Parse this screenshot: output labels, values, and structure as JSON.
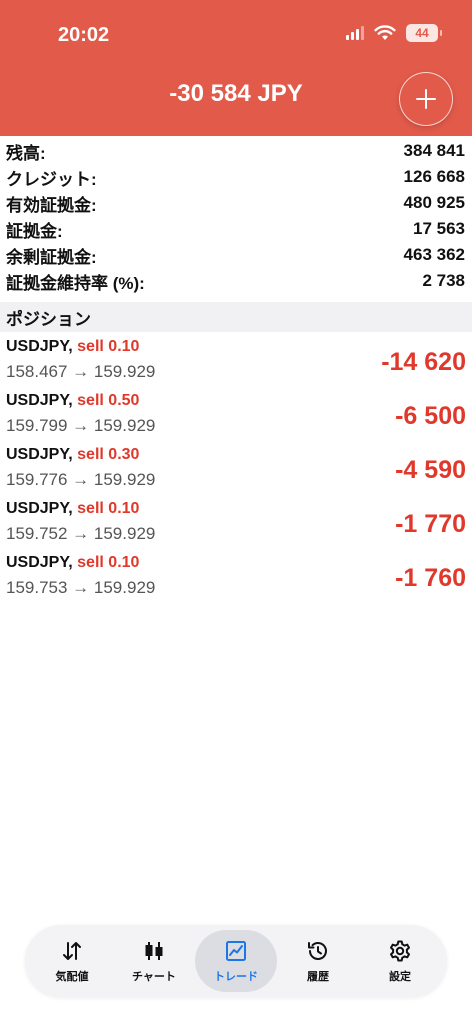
{
  "status_bar": {
    "time": "20:02",
    "battery": "44"
  },
  "header": {
    "balance": "-30 584 JPY"
  },
  "summary": [
    {
      "label": "残高:",
      "value": "384 841"
    },
    {
      "label": "クレジット:",
      "value": "126 668"
    },
    {
      "label": "有効証拠金:",
      "value": "480 925"
    },
    {
      "label": "証拠金:",
      "value": "17 563"
    },
    {
      "label": "余剰証拠金:",
      "value": "463 362"
    },
    {
      "label": "証拠金維持率 (%):",
      "value": "2 738"
    }
  ],
  "positions_section": {
    "title": "ポジション"
  },
  "positions": [
    {
      "symbol": "USDJPY,",
      "side": "sell 0.10",
      "prices": "158.467 → 159.929",
      "profit": "-14 620"
    },
    {
      "symbol": "USDJPY,",
      "side": "sell 0.50",
      "prices": "159.799 → 159.929",
      "profit": "-6 500"
    },
    {
      "symbol": "USDJPY,",
      "side": "sell 0.30",
      "prices": "159.776 → 159.929",
      "profit": "-4 590"
    },
    {
      "symbol": "USDJPY,",
      "side": "sell 0.10",
      "prices": "159.752 → 159.929",
      "profit": "-1 770"
    },
    {
      "symbol": "USDJPY,",
      "side": "sell 0.10",
      "prices": "159.753 → 159.929",
      "profit": "-1 760"
    }
  ],
  "tabs": [
    {
      "label": "気配値",
      "icon": "quotes-icon"
    },
    {
      "label": "チャート",
      "icon": "chart-icon"
    },
    {
      "label": "トレード",
      "icon": "trade-icon",
      "active": true
    },
    {
      "label": "履歴",
      "icon": "history-icon"
    },
    {
      "label": "設定",
      "icon": "settings-icon"
    }
  ],
  "colors": {
    "header": "#e25a4a",
    "loss": "#e0382b",
    "active_tab": "#1d76e8"
  }
}
